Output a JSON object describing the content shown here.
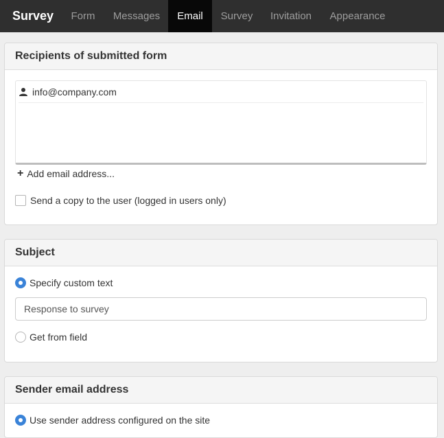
{
  "nav": {
    "brand": "Survey",
    "tabs": [
      {
        "label": "Form"
      },
      {
        "label": "Messages"
      },
      {
        "label": "Email"
      },
      {
        "label": "Survey"
      },
      {
        "label": "Invitation"
      },
      {
        "label": "Appearance"
      }
    ],
    "active_tab": "Email"
  },
  "recipients": {
    "heading": "Recipients of submitted form",
    "items": [
      {
        "email": "info@company.com",
        "icon": "user-icon"
      }
    ],
    "add_label": "Add email address...",
    "copy_label": "Send a copy to the user (logged in users only)",
    "copy_checked": false
  },
  "subject": {
    "heading": "Subject",
    "option_custom": "Specify custom text",
    "custom_value": "Response to survey",
    "option_field": "Get from field",
    "selected": "custom"
  },
  "sender": {
    "heading": "Sender email address",
    "option_site": "Use sender address configured on the site",
    "selected": "site"
  },
  "colors": {
    "accent": "#3a83d8",
    "navbar": "#2f2f2f",
    "active_tab": "#080808"
  }
}
